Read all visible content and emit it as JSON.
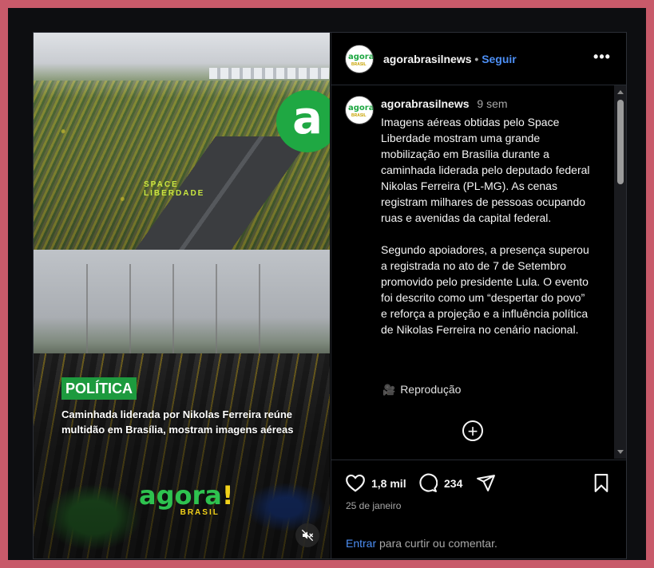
{
  "post": {
    "media": {
      "tag": "POLÍTICA",
      "headline": "Caminhada liderada por Nikolas Ferreira reúne multidão em Brasília, mostram imagens aéreas",
      "watermark_letter": "a",
      "space_tag_line1": "SPACE",
      "space_tag_line2": "LIBERDADE",
      "logo_word": "agora",
      "logo_bang": "!",
      "logo_sub": "BRASIL",
      "mute_icon": "muted-speaker-icon"
    },
    "header": {
      "username": "agorabrasilnews",
      "separator": "•",
      "follow_label": "Seguir",
      "more_icon": "•••",
      "avatar_word": "agora",
      "avatar_sub": "BRASIL"
    },
    "caption": {
      "username": "agorabrasilnews",
      "time_ago": "9 sem",
      "paragraph1": "Imagens aéreas obtidas pelo Space Liberdade mostram uma grande mobilização em Brasília durante a caminhada liderada pelo deputado federal Nikolas Ferreira (PL-MG). As cenas registram milhares de pessoas ocupando ruas e avenidas da capital federal.",
      "paragraph2": "Segundo apoiadores, a presença superou a registrada no ato de 7 de Setembro promovido pelo presidente Lula. O evento foi descrito como um “despertar do povo” e reforça a projeção e a influência política de Nikolas Ferreira no cenário nacional.",
      "reproducao_icon": "🎥",
      "reproducao": "Reprodução",
      "add_comment_icon": "+"
    },
    "actions": {
      "likes": "1,8 mil",
      "comments": "234",
      "date": "25 de janeiro"
    },
    "login": {
      "link": "Entrar",
      "rest": "para curtir ou comentar."
    }
  },
  "colors": {
    "page_background": "#c85a6a",
    "brand_green": "#1fa843",
    "link_blue": "#4d8ff5"
  }
}
